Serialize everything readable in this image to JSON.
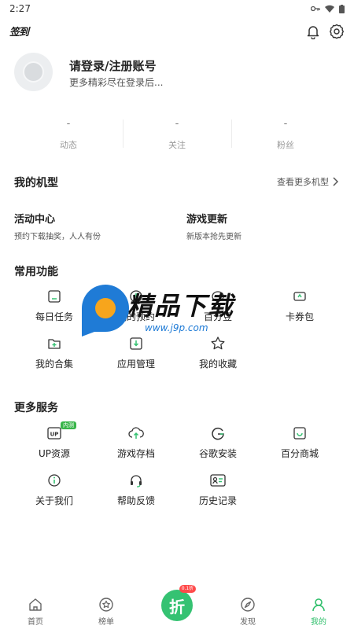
{
  "status_bar": {
    "time": "2:27"
  },
  "top_bar": {
    "signin_label": "签到"
  },
  "profile": {
    "title": "请登录/注册账号",
    "subtitle": "更多精彩尽在登录后..."
  },
  "stats": [
    {
      "value": "-",
      "label": "动态"
    },
    {
      "value": "-",
      "label": "关注"
    },
    {
      "value": "-",
      "label": "粉丝"
    }
  ],
  "my_models": {
    "title": "我的机型",
    "more_label": "查看更多机型"
  },
  "promos": [
    {
      "title": "活动中心",
      "subtitle": "预约下载抽奖，人人有份"
    },
    {
      "title": "游戏更新",
      "subtitle": "新版本抢先更新"
    }
  ],
  "common": {
    "title": "常用功能",
    "items": [
      {
        "label": "每日任务",
        "icon": "checklist-icon"
      },
      {
        "label": "我的预约",
        "icon": "clock-icon"
      },
      {
        "label": "百分豆",
        "icon": "coin-icon"
      },
      {
        "label": "卡券包",
        "icon": "ticket-icon"
      },
      {
        "label": "我的合集",
        "icon": "folder-add-icon"
      },
      {
        "label": "应用管理",
        "icon": "download-box-icon"
      },
      {
        "label": "我的收藏",
        "icon": "star-icon"
      }
    ]
  },
  "more_services": {
    "title": "更多服务",
    "items": [
      {
        "label": "UP资源",
        "icon": "up-icon",
        "badge": "内测"
      },
      {
        "label": "游戏存档",
        "icon": "cloud-upload-icon"
      },
      {
        "label": "谷歌安装",
        "icon": "google-icon"
      },
      {
        "label": "百分商城",
        "icon": "shop-icon"
      },
      {
        "label": "关于我们",
        "icon": "info-icon"
      },
      {
        "label": "帮助反馈",
        "icon": "headset-icon"
      },
      {
        "label": "历史记录",
        "icon": "id-card-icon"
      }
    ]
  },
  "watermark": {
    "text": "精品下载",
    "url": "www.j9p.com"
  },
  "tabs": [
    {
      "label": "首页",
      "icon": "home-icon"
    },
    {
      "label": "榜单",
      "icon": "rank-icon"
    },
    {
      "label": "折",
      "icon": "discount-icon",
      "tag": "0.1折"
    },
    {
      "label": "发现",
      "icon": "discover-icon"
    },
    {
      "label": "我的",
      "icon": "profile-icon",
      "active": true
    }
  ],
  "colors": {
    "accent": "#35c272",
    "active_tab": "#2fbf6b",
    "watermark_blue": "#1f7bd6",
    "watermark_orange": "#f7a51c"
  }
}
